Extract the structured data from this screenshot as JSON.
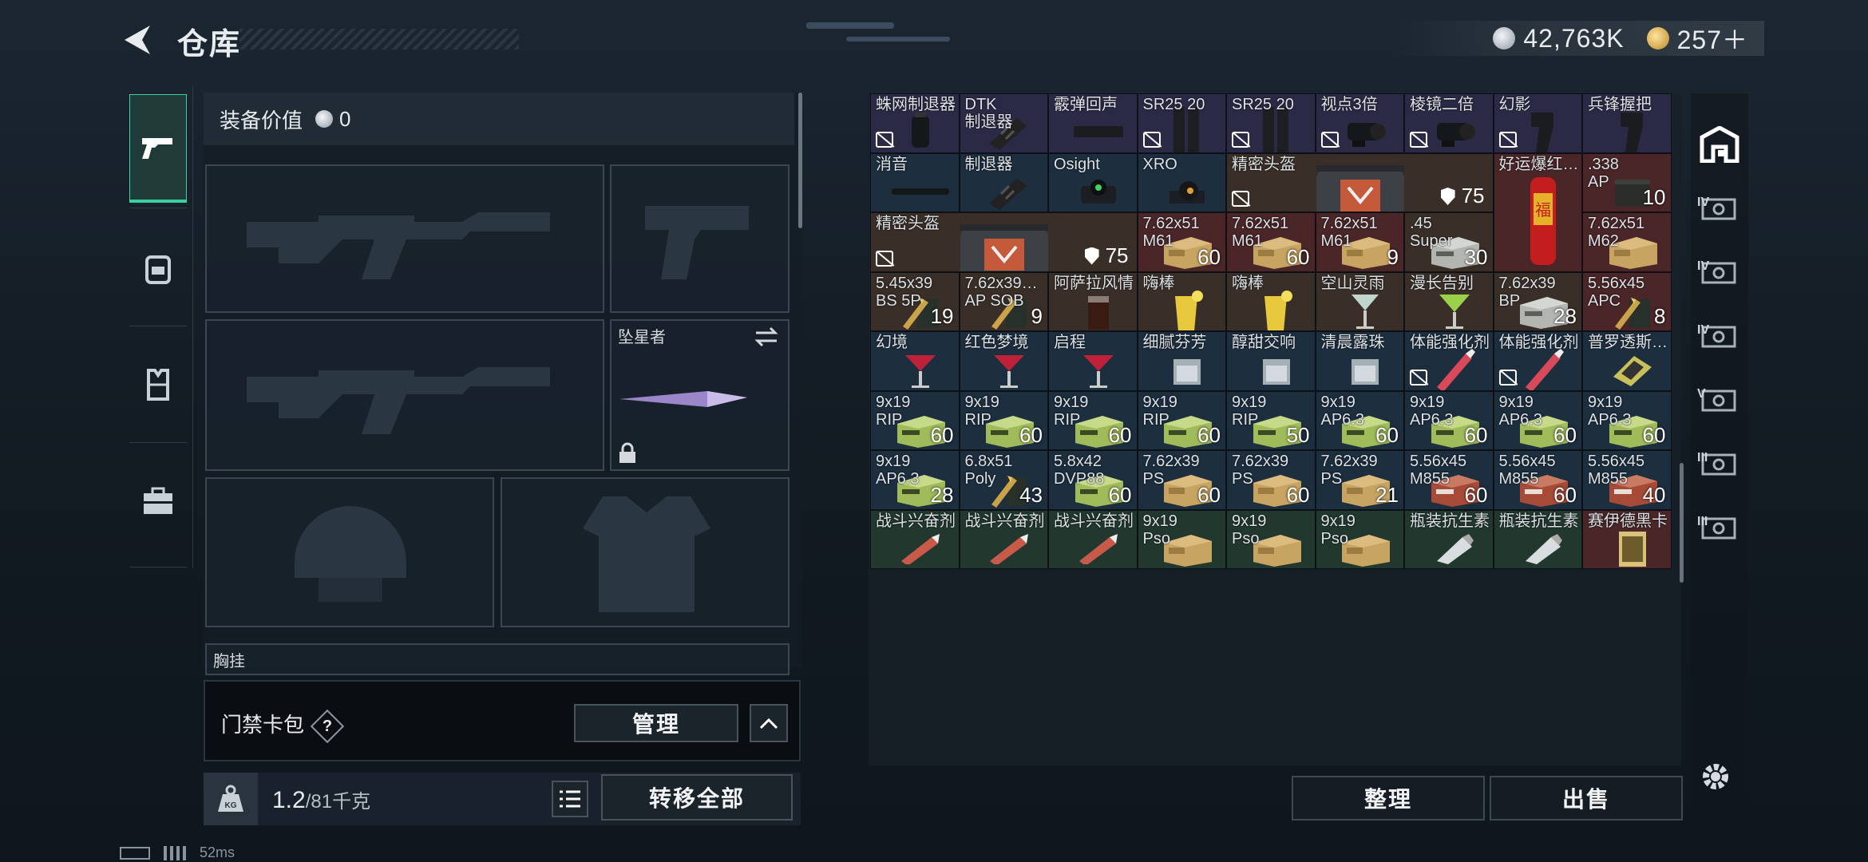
{
  "header": {
    "title": "仓库",
    "currency": [
      {
        "icon": "silver-coin-icon",
        "value": "42,763K"
      },
      {
        "icon": "gold-coin-icon",
        "value": "257＋"
      }
    ]
  },
  "nav": [
    {
      "icon": "pistol-icon",
      "active": true
    },
    {
      "icon": "backpack-icon"
    },
    {
      "icon": "vest-icon"
    },
    {
      "icon": "case-icon"
    }
  ],
  "equip": {
    "value_label": "装备价值",
    "value": "0",
    "melee_name": "坠星者",
    "chest_label": "胸挂"
  },
  "access": {
    "label": "门禁卡包",
    "help": "?",
    "manage": "管理"
  },
  "weight": {
    "current": "1.2",
    "max": "/81千克",
    "transfer": "转移全部",
    "kg_label": "KG"
  },
  "inventory": {
    "sort": "整理",
    "sell": "出售"
  },
  "status": {
    "ping": "52ms"
  },
  "items": [
    {
      "name": "蛛网制退器",
      "color": "purple",
      "pic": "muzzle",
      "nosell": true
    },
    {
      "name": "DTK\n制退器",
      "color": "purple",
      "pic": "muzzle2"
    },
    {
      "name": "霰弹回声",
      "color": "purple",
      "pic": "mag"
    },
    {
      "name": "SR25 20",
      "color": "purple",
      "pic": "magtall",
      "nosell": true
    },
    {
      "name": "SR25 20",
      "color": "purple",
      "pic": "magtall",
      "nosell": true
    },
    {
      "name": "视点3倍",
      "color": "purple",
      "pic": "scope",
      "nosell": true
    },
    {
      "name": "棱镜二倍",
      "color": "purple",
      "pic": "scope",
      "nosell": true
    },
    {
      "name": "幻影",
      "color": "purple",
      "pic": "grip",
      "nosell": true
    },
    {
      "name": "兵锋握把",
      "color": "purple",
      "pic": "grip"
    },
    {
      "name": "消音",
      "color": "blue",
      "pic": "silencer"
    },
    {
      "name": "制退器",
      "color": "blue",
      "pic": "muzzle2"
    },
    {
      "name": "Osight",
      "color": "blue",
      "pic": "sight"
    },
    {
      "name": "XRO",
      "color": "blue",
      "pic": "sight2"
    },
    {
      "name": "好运爆红…",
      "color": "red",
      "pic": "firecracker"
    },
    {
      "name": ".338\nAP",
      "color": "red",
      "pic": "ammo_dark",
      "qty": "10"
    },
    {
      "name": "精密头盔",
      "color": "brown",
      "pic": "helmetbag",
      "armor": "75",
      "nosell": true
    },
    {
      "name": "7.62x51\nM61",
      "color": "red",
      "pic": "ammo_tan",
      "qty": "60"
    },
    {
      "name": "7.62x51\nM61",
      "color": "red",
      "pic": "ammo_tan",
      "qty": "60"
    },
    {
      "name": "7.62x51\nM61",
      "color": "red",
      "pic": "ammo_tan",
      "qty": "9"
    },
    {
      "name": ".45\nSuper",
      "color": "brown",
      "pic": "ammo_grey",
      "qty": "30"
    },
    {
      "name": "7.62x51\nM62",
      "color": "red",
      "pic": "ammo_tan",
      "qty": ""
    },
    {
      "name": "5.45x39\nBS 5P",
      "color": "brown",
      "pic": "ammo_bullet",
      "qty": "19"
    },
    {
      "name": "7.62x39…\nAP SOB",
      "color": "brown",
      "pic": "ammo_bullet",
      "qty": "9"
    },
    {
      "name": "阿萨拉风情",
      "color": "brown",
      "pic": "drink_dark"
    },
    {
      "name": "嗨棒",
      "color": "brown",
      "pic": "drink_yellow"
    },
    {
      "name": "嗨棒",
      "color": "brown",
      "pic": "drink_yellow"
    },
    {
      "name": "空山灵雨",
      "color": "brown",
      "pic": "cocktail_clear"
    },
    {
      "name": "漫长告别",
      "color": "brown",
      "pic": "cocktail_green"
    },
    {
      "name": "7.62x39\nBP",
      "color": "brown",
      "pic": "ammo_grey",
      "qty": "28"
    },
    {
      "name": "5.56x45\nAPC",
      "color": "red",
      "pic": "ammo_bullet",
      "qty": "8"
    },
    {
      "name": "幻境",
      "color": "blue",
      "pic": "cocktail_red"
    },
    {
      "name": "红色梦境",
      "color": "blue",
      "pic": "cocktail_red"
    },
    {
      "name": "启程",
      "color": "blue",
      "pic": "cocktail_red"
    },
    {
      "name": "细腻芬芳",
      "color": "blue",
      "pic": "rock_glass"
    },
    {
      "name": "醇甜交响",
      "color": "blue",
      "pic": "rock_glass"
    },
    {
      "name": "清晨露珠",
      "color": "blue",
      "pic": "rock_glass"
    },
    {
      "name": "体能强化剂",
      "color": "blue",
      "pic": "syringe",
      "nosell": true
    },
    {
      "name": "体能强化剂",
      "color": "blue",
      "pic": "syringe",
      "nosell": true
    },
    {
      "name": "普罗透斯…",
      "color": "blue",
      "pic": "chip"
    },
    {
      "name": "9x19\nRIP",
      "color": "blue",
      "pic": "ammo_green",
      "qty": "60"
    },
    {
      "name": "9x19\nRIP",
      "color": "blue",
      "pic": "ammo_green",
      "qty": "60"
    },
    {
      "name": "9x19\nRIP",
      "color": "blue",
      "pic": "ammo_green",
      "qty": "60"
    },
    {
      "name": "9x19\nRIP",
      "color": "blue",
      "pic": "ammo_green",
      "qty": "60"
    },
    {
      "name": "9x19\nRIP",
      "color": "blue",
      "pic": "ammo_green",
      "qty": "50"
    },
    {
      "name": "9x19\nAP6.3",
      "color": "blue",
      "pic": "ammo_green",
      "qty": "60"
    },
    {
      "name": "9x19\nAP6.3",
      "color": "blue",
      "pic": "ammo_green",
      "qty": "60"
    },
    {
      "name": "9x19\nAP6.3",
      "color": "blue",
      "pic": "ammo_green",
      "qty": "60"
    },
    {
      "name": "9x19\nAP6.3",
      "color": "blue",
      "pic": "ammo_green",
      "qty": "60"
    },
    {
      "name": "9x19\nAP6.3",
      "color": "blue",
      "pic": "ammo_green",
      "qty": "28"
    },
    {
      "name": "6.8x51\nPoly",
      "color": "blue",
      "pic": "ammo_bullet",
      "qty": "43"
    },
    {
      "name": "5.8x42\nDVP88",
      "color": "blue",
      "pic": "ammo_green",
      "qty": "60"
    },
    {
      "name": "7.62x39\nPS",
      "color": "blue",
      "pic": "ammo_tan",
      "qty": "60"
    },
    {
      "name": "7.62x39\nPS",
      "color": "blue",
      "pic": "ammo_tan",
      "qty": "60"
    },
    {
      "name": "7.62x39\nPS",
      "color": "blue",
      "pic": "ammo_tan",
      "qty": "21"
    },
    {
      "name": "5.56x45\nM855",
      "color": "blue",
      "pic": "ammo_red",
      "qty": "60"
    },
    {
      "name": "5.56x45\nM855",
      "color": "blue",
      "pic": "ammo_red",
      "qty": "60"
    },
    {
      "name": "5.56x45\nM855",
      "color": "blue",
      "pic": "ammo_red",
      "qty": "40"
    },
    {
      "name": "战斗兴奋剂",
      "color": "green",
      "pic": "injector"
    },
    {
      "name": "战斗兴奋剂",
      "color": "green",
      "pic": "injector"
    },
    {
      "name": "战斗兴奋剂",
      "color": "green",
      "pic": "injector"
    },
    {
      "name": "9x19\nPso",
      "color": "green",
      "pic": "ammo_tan"
    },
    {
      "name": "9x19\nPso",
      "color": "green",
      "pic": "ammo_tan"
    },
    {
      "name": "9x19\nPso",
      "color": "green",
      "pic": "ammo_tan"
    },
    {
      "name": "瓶装抗生素",
      "color": "green",
      "pic": "bottle"
    },
    {
      "name": "瓶装抗生素",
      "color": "green",
      "pic": "bottle"
    },
    {
      "name": "赛伊德黑卡",
      "color": "red",
      "pic": "card"
    }
  ],
  "side_tiers": [
    "IV",
    "IV",
    "IV",
    "V",
    "III",
    "III"
  ]
}
